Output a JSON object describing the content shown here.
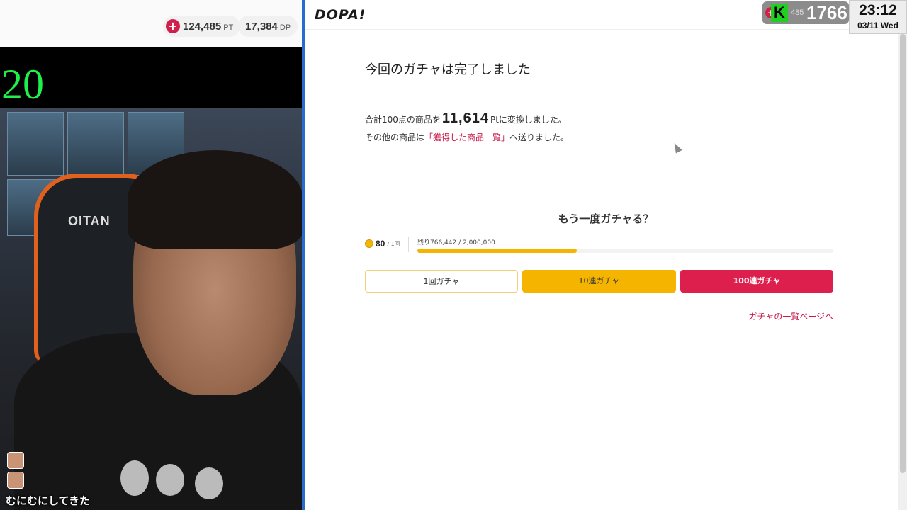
{
  "stream": {
    "points": {
      "value": "124,485",
      "unit": "PT"
    },
    "dp": {
      "value": "17,384",
      "unit": "DP"
    },
    "counter": "20",
    "subtitle": "むにむにしてきた",
    "chair_logo": "OITAN"
  },
  "browser": {
    "logo": "DOPA!",
    "overlay": {
      "small_text": "485",
      "count": "1766",
      "badge": "K"
    },
    "clock": {
      "time": "23:12",
      "date": "03/11 Wed"
    },
    "heading": "今回のガチャは完了しました",
    "message1": {
      "prefix": "合計100点の商品を",
      "amount": "11,614",
      "suffix": "Ptに変換しました。"
    },
    "message2": {
      "prefix": "その他の商品は",
      "link": "「獲得した商品一覧」",
      "suffix": "へ送りました。"
    },
    "again_title": "もう一度ガチャる？",
    "cost": {
      "value": "80",
      "unit": "/ 1回"
    },
    "stock": {
      "remaining_label": "残り766,442",
      "total": "/ 2,000,000",
      "progress_fraction": 0.383
    },
    "buttons": {
      "single": "1回ガチャ",
      "ten": "10連ガチャ",
      "hundred": "100連ガチャ"
    },
    "list_link": "ガチャの一覧ページへ",
    "colors": {
      "accent_red": "#dc1f4c",
      "accent_yellow": "#f4b400",
      "counter_green": "#1ff04a"
    }
  }
}
